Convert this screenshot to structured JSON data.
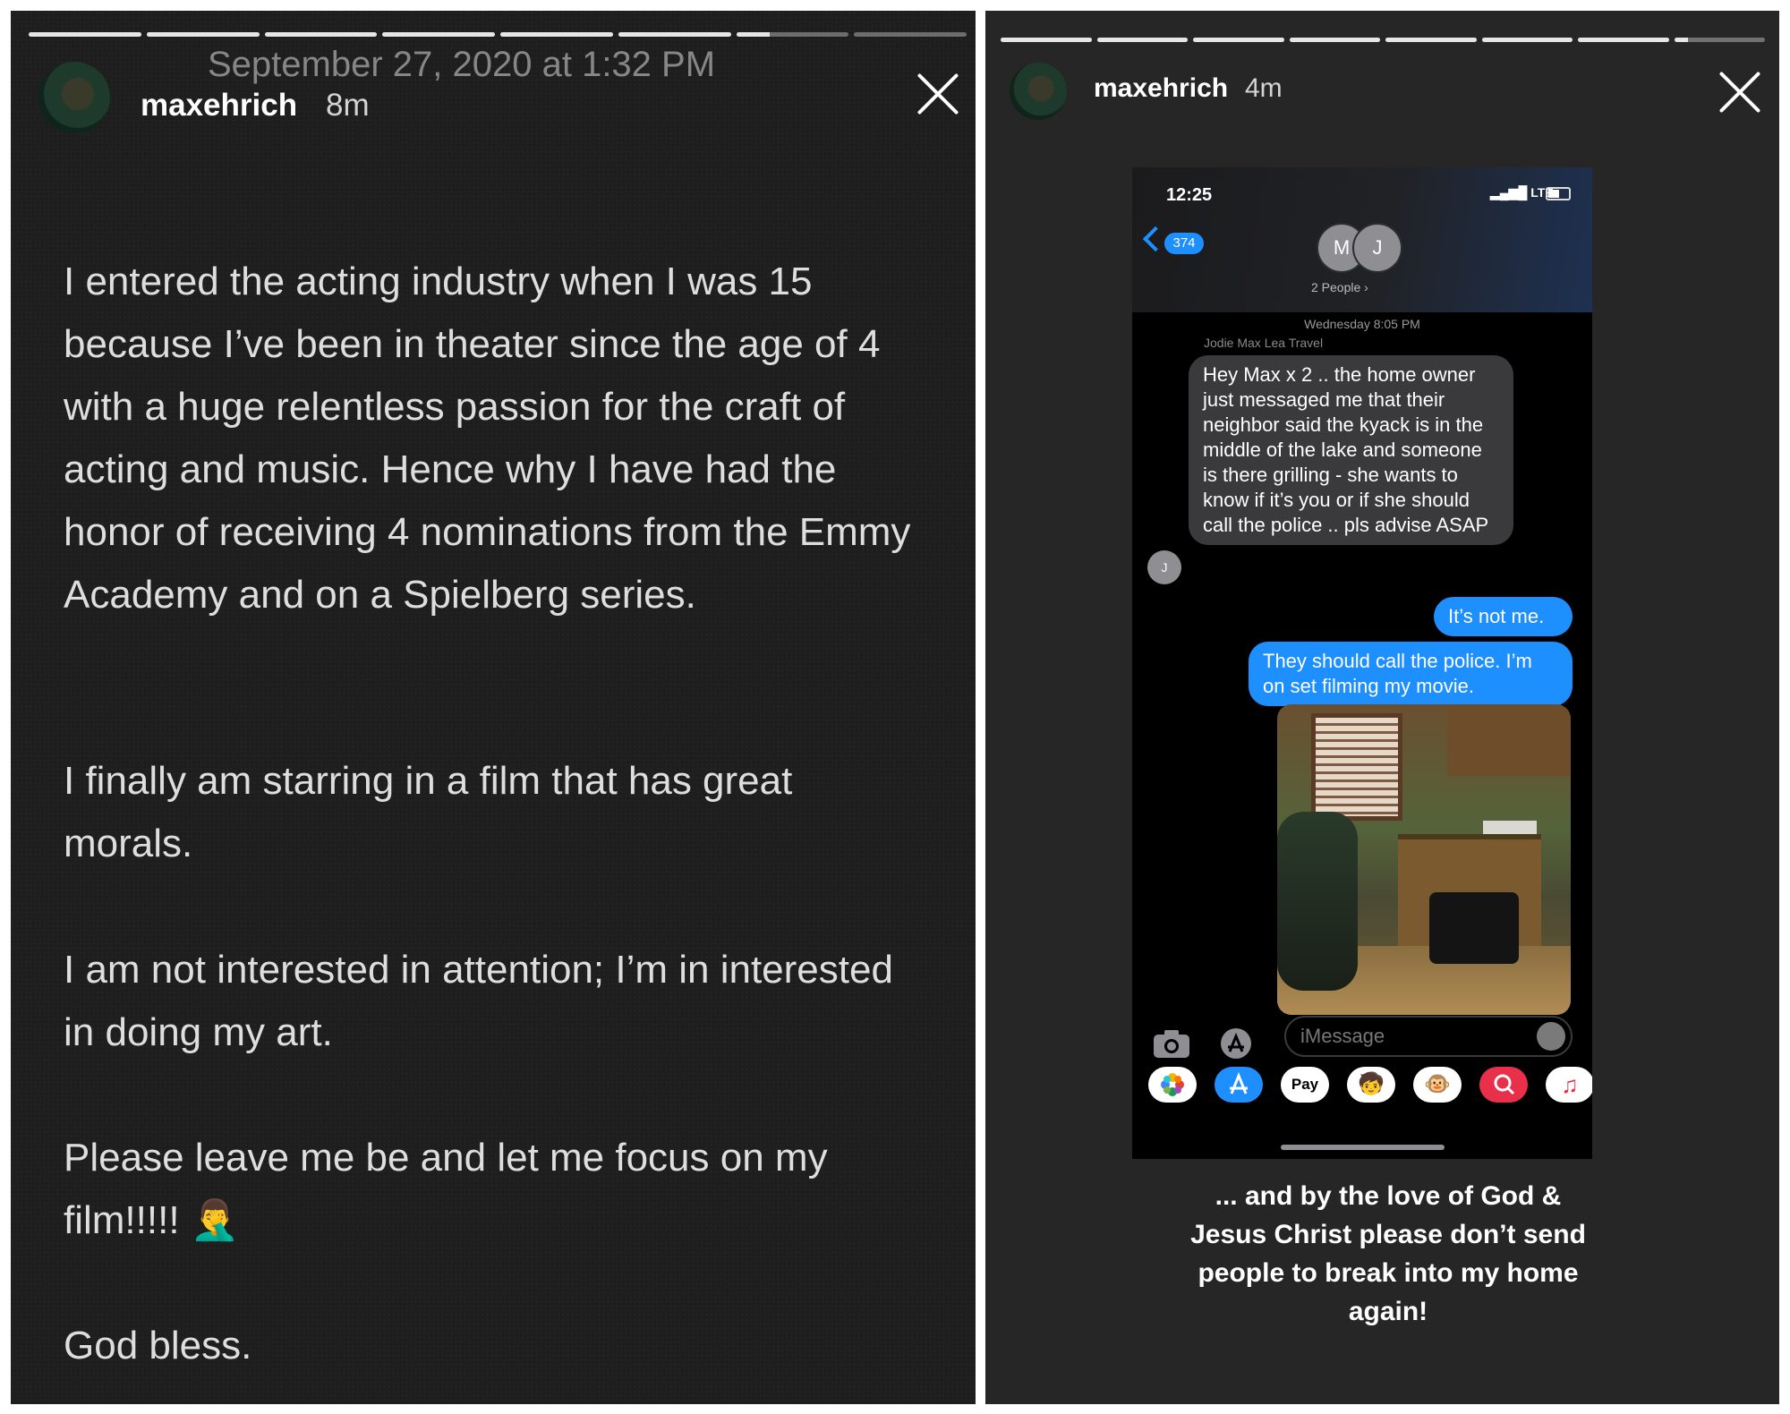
{
  "left_story": {
    "username": "maxehrich",
    "age": "8m",
    "date_overlay": "September 27, 2020 at 1:32 PM",
    "paragraphs": [
      "I entered the acting industry when I was 15 because I’ve been in theater since the age of 4 with a huge relentless passion for the craft of acting and music. Hence why I have had the honor of receiving 4 nominations from the Emmy Academy and on a Spielberg series.",
      "I finally am starring in a film that has great morals.",
      "I am not interested in attention; I’m in interested in doing my art.",
      "Please leave me be and let me focus on my film!!!!! 🤦‍♂️",
      "God bless."
    ],
    "progress": [
      1,
      1,
      1,
      1,
      1,
      1,
      0.3,
      0
    ]
  },
  "right_story": {
    "username": "maxehrich",
    "age": "4m",
    "progress": [
      1,
      1,
      1,
      1,
      1,
      1,
      1,
      0.15
    ],
    "phone": {
      "status_time": "12:25",
      "status_signal": "▂▄▆█ LTE",
      "back_count": "374",
      "contact_initials": [
        "M",
        "J"
      ],
      "group_label": "2 People ›",
      "timestamp": "Wednesday 8:05 PM",
      "sender_name": "Jodie Max Lea Travel",
      "incoming_avatar": "J",
      "messages": {
        "incoming": "Hey Max x 2 .. the home owner just messaged me that their neighbor said the kyack is in the middle of the lake and someone is there grilling - she wants to know if it’s you or if she should call the police .. pls advise ASAP",
        "outgoing_1": "It’s not me.",
        "outgoing_2": "They should call the police. I’m on set filming my movie."
      },
      "input_placeholder": "iMessage",
      "app_drawer": [
        "photos-icon",
        "app-store-icon",
        "Pay",
        "memoji-icon",
        "monkey-icon",
        "search-icon",
        "music-icon"
      ],
      "apple_pay_label": "Pay"
    },
    "caption": "... and by the love of God & Jesus Christ please don’t send people to break into my home again!"
  },
  "colors": {
    "imessage_blue": "#1e8fff",
    "bubble_grey": "#3a3a3c",
    "story_bg": "#262626"
  }
}
